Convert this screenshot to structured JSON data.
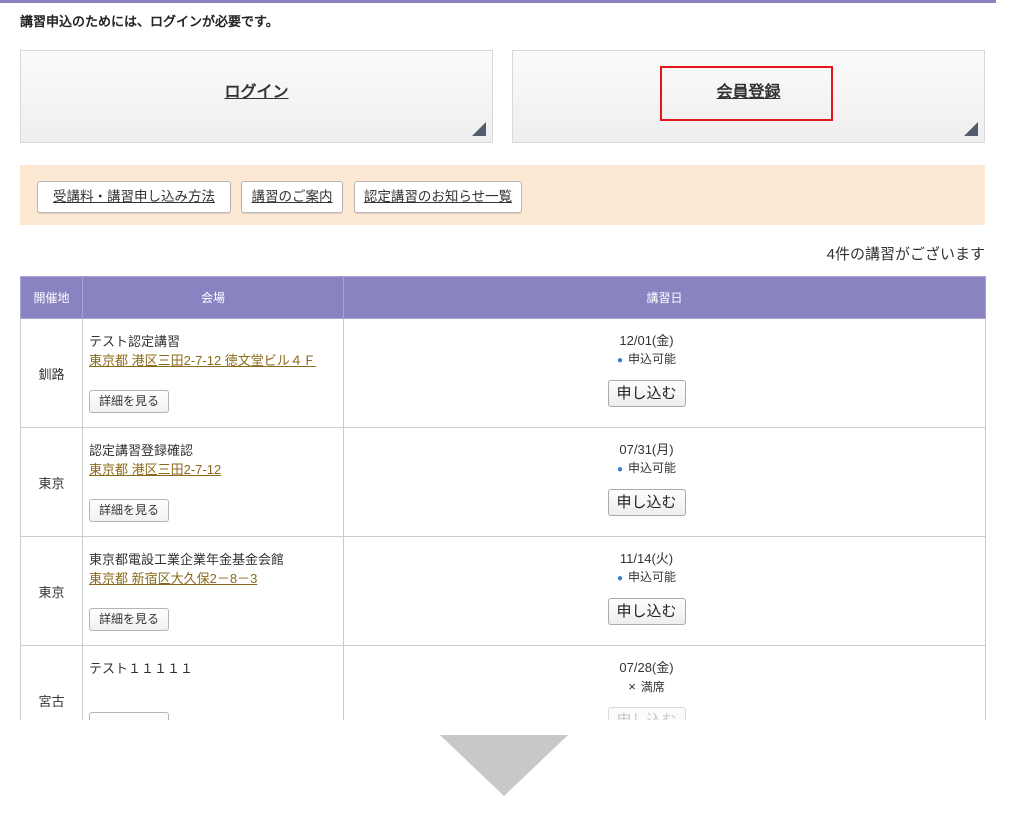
{
  "notice": "講習申込のためには、ログインが必要です。",
  "auth": {
    "login_label": "ログイン",
    "register_label": "会員登録"
  },
  "quick_links": [
    "受講料・講習申し込み方法",
    "講習のご案内",
    "認定講習のお知らせ一覧"
  ],
  "course_count": "4件の講習がございます",
  "table": {
    "headers": {
      "region": "開催地",
      "venue": "会場",
      "date": "講習日"
    },
    "rows": [
      {
        "region": "釧路",
        "venue": "テスト認定講習",
        "address": "東京都 港区三田2-7-12 徳文堂ビル４Ｆ",
        "detail_label": "詳細を見る",
        "date": "12/01(金)",
        "status_icon": "●",
        "status": "申込可能",
        "apply_label": "申し込む",
        "apply_enabled": true
      },
      {
        "region": "東京",
        "venue": "認定講習登録確認",
        "address": "東京都 港区三田2-7-12",
        "detail_label": "詳細を見る",
        "date": "07/31(月)",
        "status_icon": "●",
        "status": "申込可能",
        "apply_label": "申し込む",
        "apply_enabled": true
      },
      {
        "region": "東京",
        "venue": "東京都電設工業企業年金基金会館",
        "address": "東京都 新宿区大久保2－8－3",
        "detail_label": "詳細を見る",
        "date": "11/14(火)",
        "status_icon": "●",
        "status": "申込可能",
        "apply_label": "申し込む",
        "apply_enabled": true
      },
      {
        "region": "宮古",
        "venue": "テスト１１１１１",
        "date": "07/28(金)",
        "status_icon": "×",
        "status": "満席",
        "apply_label": "申し込む",
        "apply_enabled": false
      }
    ]
  },
  "colors": {
    "accent": "#8a83c2",
    "link_band": "#fde8d3",
    "link": "#8b6b1b",
    "available": "#2e7fd9",
    "highlight": "#e3161c",
    "corner": "#525d6c",
    "arrow": "#c8c8c8"
  }
}
